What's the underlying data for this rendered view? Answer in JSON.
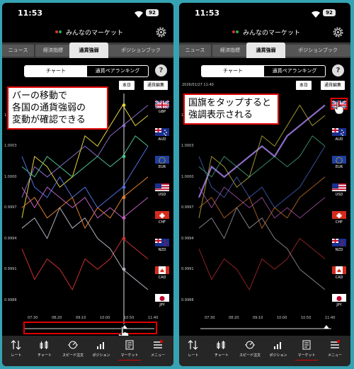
{
  "screens": [
    {
      "id": "left",
      "status": {
        "time": "11:53",
        "battery": "92"
      },
      "app_title": "みんなのマーケット",
      "tabs": [
        "ニュース",
        "経済指標",
        "通貨強弱",
        "ポジションブック"
      ],
      "active_tab": "通貨強弱",
      "segments": [
        "チャート",
        "通貨ペアランキング"
      ],
      "buttons": {
        "today": "本日",
        "edit": "通貨編集"
      },
      "date_label": "",
      "callout_lines": [
        "バーの移動で",
        "各国の通貨強弱の",
        "変動が確認できる"
      ],
      "highlighted_flag": ""
    },
    {
      "id": "right",
      "status": {
        "time": "11:53",
        "battery": "92"
      },
      "app_title": "みんなのマーケット",
      "tabs": [
        "ニュース",
        "経済指標",
        "通貨強弱",
        "ポジションブック"
      ],
      "active_tab": "通貨強弱",
      "segments": [
        "チャート",
        "通貨ペアランキング"
      ],
      "buttons": {
        "today": "本日",
        "edit": "通貨編集"
      },
      "date_label": "2026/01/27 11:40",
      "callout_lines": [
        "国旗をタップすると",
        "強調表示される"
      ],
      "highlighted_flag": "GBP"
    }
  ],
  "chart_data": {
    "type": "line",
    "title": "",
    "x": [
      "07:30",
      "08:20",
      "09:10",
      "10:00",
      "10:50",
      "11:40"
    ],
    "y_ticks": [
      "1.0006",
      "1.0003",
      "1.0000",
      "0.9997",
      "0.9994",
      "0.9991",
      "0.9988"
    ],
    "ylim": [
      0.9987,
      1.0008
    ],
    "series": [
      {
        "name": "GBP",
        "color": "#8c6cc8",
        "values": [
          0.9998,
          1.0001,
          1.0,
          1.0001,
          1.0002,
          1.0003,
          1.0002,
          1.0004,
          1.0005,
          1.0006,
          1.0007
        ]
      },
      {
        "name": "AUD",
        "color": "#e0d040",
        "values": [
          0.9996,
          1.0002,
          1.0001,
          0.9999,
          1.0,
          1.0004,
          1.0003,
          1.0005,
          1.0007,
          1.0005,
          1.0006
        ]
      },
      {
        "name": "EUR",
        "color": "#50c090",
        "values": [
          1.0001,
          1.0,
          1.0002,
          1.0001,
          1.0,
          1.0001,
          1.0002,
          1.0001,
          1.0002,
          1.0004,
          1.0003
        ]
      },
      {
        "name": "USD",
        "color": "#5070e0",
        "values": [
          1.0002,
          0.9999,
          0.9998,
          1.0,
          0.9998,
          0.9999,
          0.9997,
          0.9998,
          0.9999,
          1.0001,
          1.0003
        ]
      },
      {
        "name": "CHF",
        "color": "#e08030",
        "values": [
          0.9997,
          0.9998,
          0.9996,
          0.9997,
          0.9998,
          0.9995,
          0.9997,
          0.9996,
          0.9998,
          0.9999,
          1.0
        ]
      },
      {
        "name": "NZD",
        "color": "#c060c0",
        "values": [
          0.9999,
          0.9997,
          0.9999,
          0.9998,
          0.9997,
          0.9998,
          0.9996,
          0.9997,
          0.9996,
          0.9997,
          0.9998
        ]
      },
      {
        "name": "CAD",
        "color": "#c83030",
        "values": [
          0.9993,
          0.999,
          0.9992,
          0.9991,
          0.9989,
          0.9992,
          0.9991,
          0.9992,
          0.9994,
          0.9993,
          0.9992
        ]
      },
      {
        "name": "JPY",
        "color": "#b0b0c0",
        "values": [
          0.9995,
          0.9996,
          0.9994,
          0.9997,
          0.9995,
          0.9996,
          0.9994,
          0.9993,
          0.9991,
          0.999,
          0.9989
        ]
      }
    ],
    "grid": false,
    "legend": "right-flags"
  },
  "nav": [
    "レート",
    "チャート",
    "スピード注文",
    "ポジション",
    "マーケット",
    "メニュー"
  ],
  "active_nav": "マーケット",
  "colors": {
    "highlight_red": "#e00000",
    "background": "#36a3b3"
  }
}
